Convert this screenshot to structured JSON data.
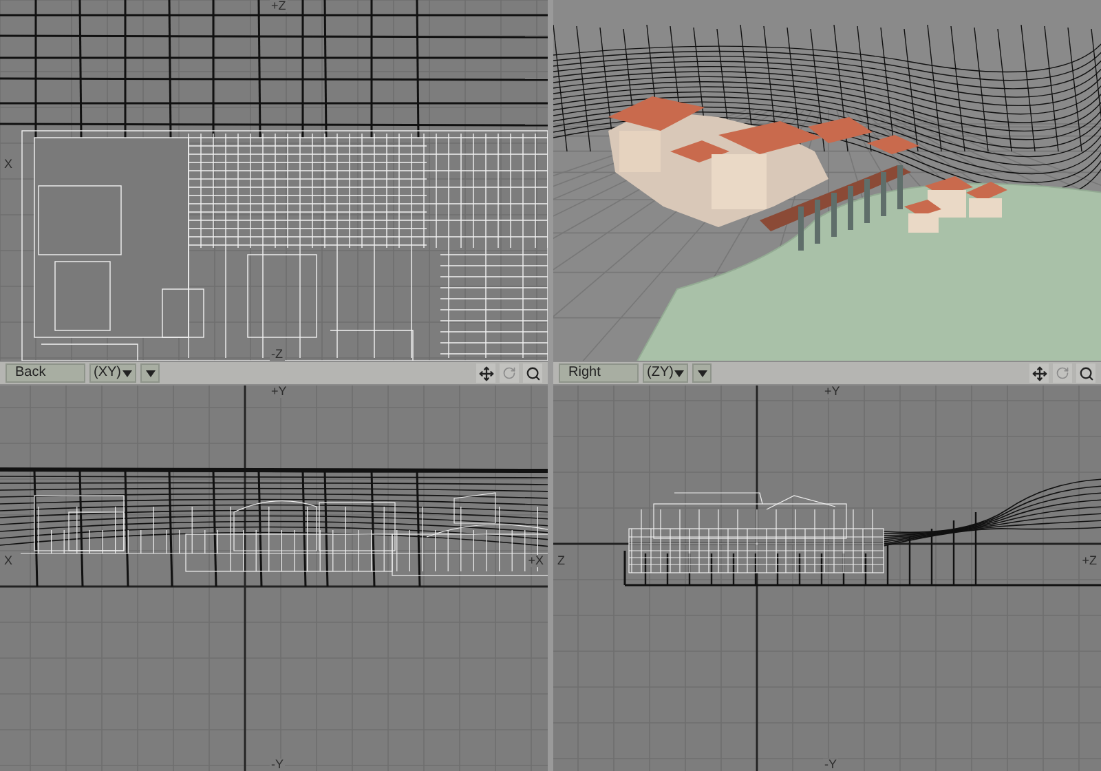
{
  "viewports": [
    {
      "kind": "top",
      "axis_labels": {
        "top": "+Z",
        "left": "X",
        "bottom": "-Z"
      }
    },
    {
      "kind": "perspective"
    },
    {
      "kind": "back",
      "header": {
        "view": "Back",
        "plane": "(XY)"
      },
      "axis_labels": {
        "top": "+Y",
        "left": "X",
        "right": "+X",
        "bottom": "-Y"
      }
    },
    {
      "kind": "right",
      "header": {
        "view": "Right",
        "plane": "(ZY)"
      },
      "axis_labels": {
        "top": "+Y",
        "left": "Z",
        "right": "+Z",
        "bottom": "-Y"
      }
    }
  ]
}
